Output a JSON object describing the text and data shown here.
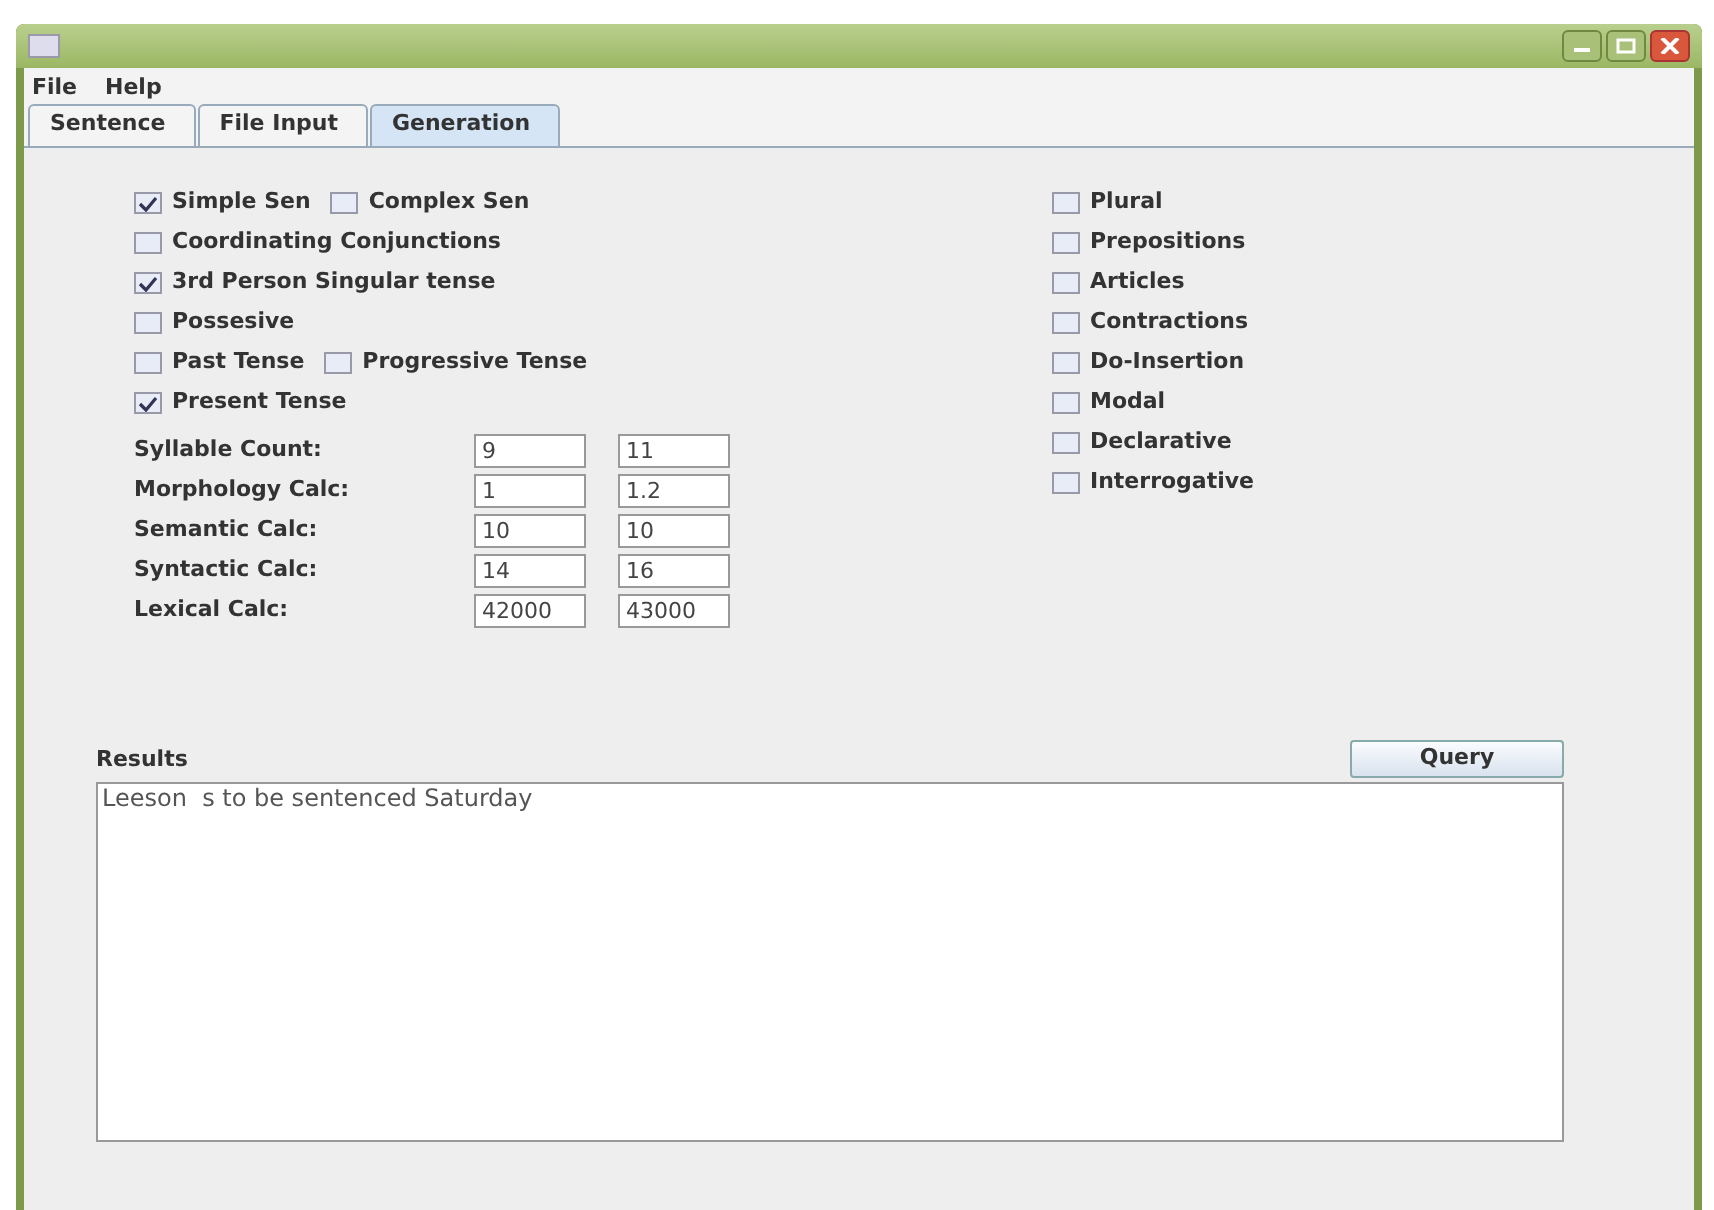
{
  "menu": [
    "File",
    "Help"
  ],
  "tabs": [
    {
      "label": "Sentence",
      "selected": false
    },
    {
      "label": "File Input",
      "selected": false
    },
    {
      "label": "Generation",
      "selected": true
    }
  ],
  "left_options": [
    [
      {
        "label": "Simple Sen",
        "checked": true
      },
      {
        "label": "Complex Sen",
        "checked": false
      }
    ],
    [
      {
        "label": "Coordinating Conjunctions",
        "checked": false
      }
    ],
    [
      {
        "label": "3rd Person Singular tense",
        "checked": true
      }
    ],
    [
      {
        "label": "Possesive",
        "checked": false
      }
    ],
    [
      {
        "label": "Past Tense",
        "checked": false
      },
      {
        "label": "Progressive Tense",
        "checked": false
      }
    ],
    [
      {
        "label": "Present Tense",
        "checked": true
      }
    ]
  ],
  "calcs": [
    {
      "label": "Syllable Count:",
      "min": "9",
      "max": "11"
    },
    {
      "label": "Morphology Calc:",
      "min": "1",
      "max": "1.2"
    },
    {
      "label": "Semantic Calc:",
      "min": "10",
      "max": "10"
    },
    {
      "label": "Syntactic Calc:",
      "min": "14",
      "max": "16"
    },
    {
      "label": "Lexical Calc:",
      "min": "42000",
      "max": "43000"
    }
  ],
  "right_options": [
    {
      "label": "Plural",
      "checked": false
    },
    {
      "label": "Prepositions",
      "checked": false
    },
    {
      "label": "Articles",
      "checked": false
    },
    {
      "label": "Contractions",
      "checked": false
    },
    {
      "label": "Do-Insertion",
      "checked": false
    },
    {
      "label": "Modal",
      "checked": false
    },
    {
      "label": "Declarative",
      "checked": false
    },
    {
      "label": "Interrogative",
      "checked": false
    }
  ],
  "results": {
    "label": "Results",
    "text": "Leeson  s to be sentenced Saturday"
  },
  "query_button": "Query"
}
